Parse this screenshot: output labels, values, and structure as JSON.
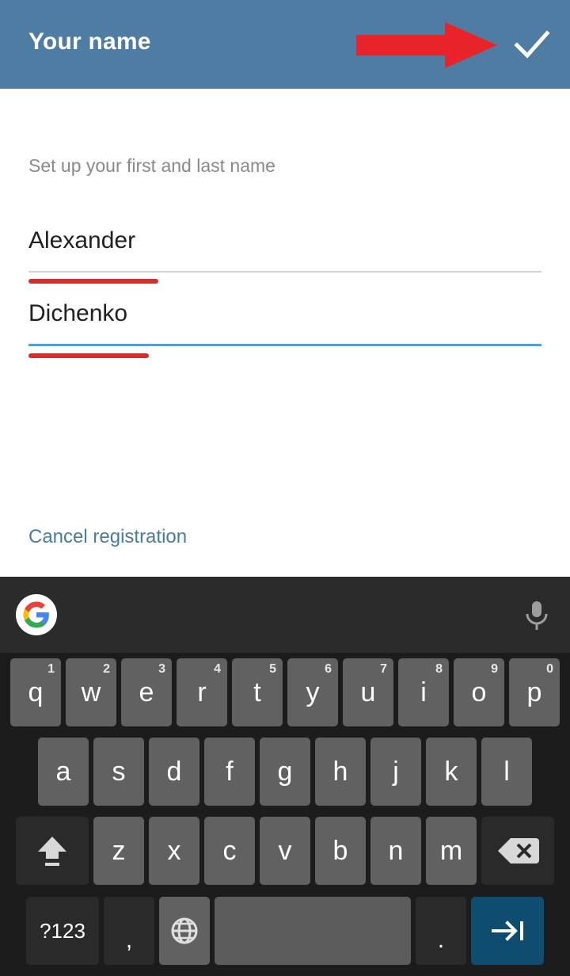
{
  "header": {
    "title": "Your name",
    "confirm_icon": "check-icon",
    "annotation_icon": "red-arrow-annotation",
    "background_color": "#4F7CA3",
    "annotation_color": "#E8232A"
  },
  "form": {
    "hint": "Set up your first and last name",
    "fields": [
      {
        "name": "first-name",
        "value": "Alexander",
        "placeholder": "First name",
        "focused": false,
        "underline_color": "#D3D3D3",
        "spellcheck_color": "#D32F2F"
      },
      {
        "name": "last-name",
        "value": "Dichenko",
        "placeholder": "Last name",
        "focused": true,
        "underline_color": "#42A5DC",
        "spellcheck_color": "#D32F2F"
      }
    ],
    "cancel_link": "Cancel registration",
    "cancel_link_color": "#4A7CA0"
  },
  "keyboard": {
    "toolbar": {
      "logo_icon": "google-g-icon",
      "mic_icon": "microphone-icon"
    },
    "row_numbers": [
      "1",
      "2",
      "3",
      "4",
      "5",
      "6",
      "7",
      "8",
      "9",
      "0"
    ],
    "row_top": [
      "q",
      "w",
      "e",
      "r",
      "t",
      "y",
      "u",
      "i",
      "o",
      "p"
    ],
    "row_home": [
      "a",
      "s",
      "d",
      "f",
      "g",
      "h",
      "j",
      "k",
      "l"
    ],
    "row_bottom": [
      "z",
      "x",
      "c",
      "v",
      "b",
      "n",
      "m"
    ],
    "shift_icon": "shift-icon",
    "backspace_icon": "backspace-icon",
    "symbols_label": "?123",
    "comma_label": ",",
    "globe_icon": "language-globe-icon",
    "space_label": "",
    "period_label": ".",
    "action_icon": "next-field-tab-icon",
    "action_key_color": "#0E4D70",
    "key_color": "#616161",
    "dark_key_color": "#2A2A2A",
    "space_key_color": "#5C5C5C",
    "background_color": "#1C1C1C",
    "toolbar_color": "#2B2B2B"
  }
}
